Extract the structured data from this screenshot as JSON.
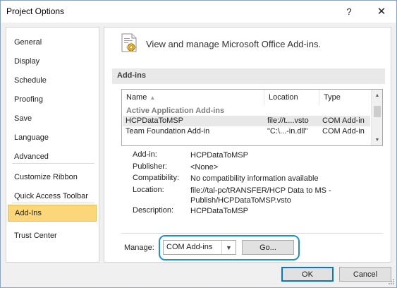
{
  "window": {
    "title": "Project Options",
    "help_glyph": "?",
    "close_glyph": "✕"
  },
  "sidebar": {
    "items": [
      {
        "label": "General"
      },
      {
        "label": "Display"
      },
      {
        "label": "Schedule"
      },
      {
        "label": "Proofing"
      },
      {
        "label": "Save"
      },
      {
        "label": "Language"
      },
      {
        "label": "Advanced"
      },
      {
        "label": "Customize Ribbon"
      },
      {
        "label": "Quick Access Toolbar"
      },
      {
        "label": "Add-Ins"
      },
      {
        "label": "Trust Center"
      }
    ],
    "selected": "Add-Ins"
  },
  "header": {
    "text": "View and manage Microsoft Office Add-ins.",
    "icon": "addins-gear-icon"
  },
  "section": {
    "label": "Add-ins"
  },
  "addins_table": {
    "columns": [
      "Name",
      "Location",
      "Type"
    ],
    "sorted_column": "Name",
    "group_label": "Active Application Add-ins",
    "rows": [
      {
        "name": "HCPDataToMSP",
        "location": "file://t....vsto",
        "type": "COM Add-in",
        "selected": true
      },
      {
        "name": "Team Foundation Add-in",
        "location": "\"C:\\...-in.dll\"",
        "type": "COM Add-in",
        "selected": false
      }
    ]
  },
  "details": {
    "addin_label": "Add-in:",
    "addin_value": "HCPDataToMSP",
    "publisher_label": "Publisher:",
    "publisher_value": "<None>",
    "compatibility_label": "Compatibility:",
    "compatibility_value": "No compatibility information available",
    "location_label": "Location:",
    "location_value_line1": "file://tal-pc/tRANSFER/HCP Data to MS -",
    "location_value_line2": "Publish/HCPDataToMSP.vsto",
    "description_label": "Description:",
    "description_value": "HCPDataToMSP"
  },
  "manage": {
    "label": "Manage:",
    "selected_option": "COM Add-ins",
    "go_label": "Go..."
  },
  "footer": {
    "ok_label": "OK",
    "cancel_label": "Cancel"
  },
  "colors": {
    "selected_nav_bg": "#fcd779",
    "highlight_outline": "#1e8fd6",
    "default_button_border": "#0078d7"
  }
}
